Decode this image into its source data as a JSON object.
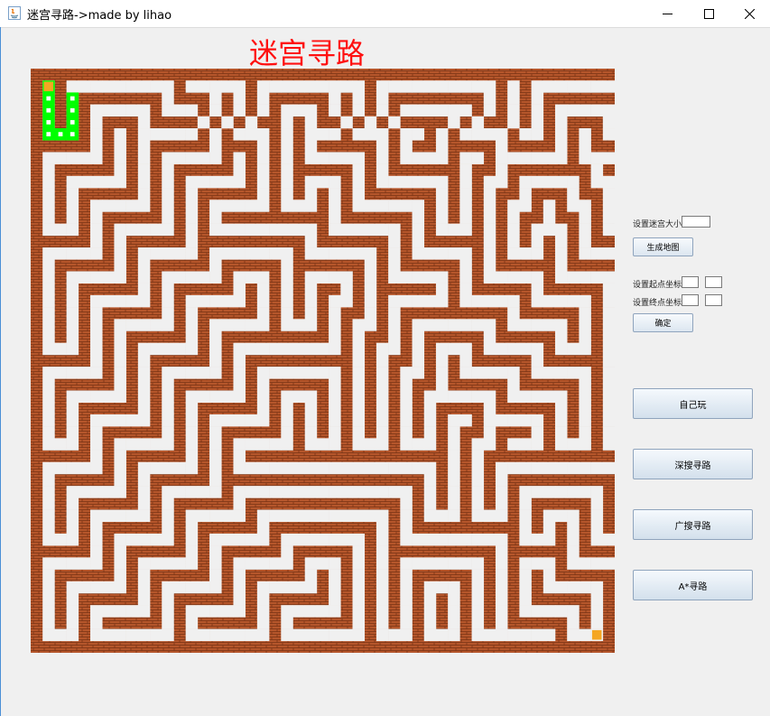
{
  "window": {
    "title": "迷宫寻路->made by lihao",
    "controls": [
      "minimize-icon",
      "maximize-icon",
      "close-icon"
    ]
  },
  "heading": "迷宫寻路",
  "colors": {
    "heading": "#ff1010",
    "wall": "#b5562b",
    "mortar": "#7a3414",
    "path": "#f0f0f0",
    "visited": "#00ff00",
    "route": "#0b3a0b",
    "marker": "#f5a623"
  },
  "maze": {
    "rows": 25,
    "cols": 25,
    "grid": [
      "wwwwwwwwwwwwwwwwwwwwwwwwwwwwwwwwwwwwwwwwwwwwwwwwwwwww",
      "w.w.........w.....w.........w..........w.w.........w",
      "w.w.wwwwwww.www.w.w.wwwww.w.w.wwwwwwww.w.w.wwwwwww.w",
      "w.w.w.....w...w.w.w.w...w.w.w.w......w.w.w.w.....w.w",
      "w.w.w.www.wwww.w.w.ww.w.ww.w.w.wwww.w.ww.w.w.www.w.w",
      "w...w.w.w.....w.w...w.w...w...w..w.w....w..w.w.w...w",
      "wwwww.w.w.wwwww.www.w.w.wwwww.w.ww.wwww.wwww.w.wwwww",
      "w.....w.w.w.....w.w.w.w.....w.w....w..w......w.....w",
      "w.wwwww.w.w.wwwww.w.w.wwwww.w.wwwwww.ww.wwwwwww.ww.w",
      "w.w.....w.w.w.....w.w.w...w.w......w.w..w.....w..w.w",
      "w.w.wwwww.w.w.wwwww.w.w.w.w.wwwwww.w.w.ww.www.ww.w.w",
      "w.w.w.....w.w.w.....w...w.w......w.w.w.w..w.w..w.w.w",
      "w.w.w.wwwww.w.w.wwwwwwwww.wwwwww.w.w.w.w.ww.ww.w.w.w",
      "w...w.w.....w.w.........w......w.w...w.w.w...w.w...w",
      "wwwww.w.wwwww.wwwwwwwww.wwwwww.w.wwwww.w.w.w.w.wwwww",
      "w.....w.w.....w.......w......w.w.....w.w...w.w.....w",
      "w.wwwww.w.wwwww.wwwww.wwwwww.w.wwwww.w.wwwww.wwwww.w",
      "w.w.....w.w.....w...w.w....w.w.....w.w.....w.....w.w",
      "w.w.wwwww.w.wwwww.w.w.w.ww.w.wwwww.w.wwwww.wwwww.w.w",
      "w.w.w.....w.w.....w.w.w.w..w.w.....w.....w.....w.w.w",
      "w.w.w.wwwww.w.wwwww.w.w.w.ww.w.wwwwwwwww.wwwww.w.w.w",
      "w.w.w.w.....w.w.....w...w.w..w.w.......w.....w.w.w.w",
      "w.w.w.w.wwwww.w.wwwwwwwww.w.ww.w.wwwww.wwwww.w.w.w.w",
      "w...w.w.w.....w.w.........w.w..w.w...w.....w...w...w",
      "wwwww.w.w.wwwww.w.wwwwwwwww.w.ww.w.w.wwwww.wwwww.w.w",
      "w.....w.w.w.....w.w.......w.w.w..w.w.....w.....w.w.w",
      "w.wwwww.w.w.wwwww.w.wwwww.w.w.w.ww.wwwww.wwwww.w.w.w",
      "w.w.....w.w.w.....w.w...w.w.w.w.w......w.....w.w.w.w",
      "w.w.wwwww.w.w.wwwww.w.w.w.w.w.w.w.wwww.wwwww.w.w.w.w",
      "w.w.w.....w.w.w.....w.w.w.w.w.w.w.w..w.....w.w.w.w.w",
      "w.w.w.wwwww.w.w.wwwww.w.w.w.w.w.w.w.ww.www.w.w.w.w.w",
      "w...w.w.....w.w.w.....w...w...w...w.w..w...w...w...w",
      "wwwww.w.wwwww.w.w.wwwwwwwwwwwwwwwww.w.wwwwwwwwwwwww.w",
      "w.....w.w.....w.w.................w.w.w...........w.w",
      "w.wwwww.w.wwwww.wwwwwwwwwwwwwwwww.w.w.w.wwwwwwwww.w.w",
      "w.w.....w.w.....w...............w.w.w.w.w.......w.w.w",
      "w.w.wwwww.w.wwwww.wwwwwwwwwwwww.w.w.w.w.w.wwwww.w.w.w",
      "w.w.w.....w.w.....w...........w.w...w...w.w...w.w...w",
      "w.w.w.wwwww.w.wwwww.wwwwwwwww.w.wwwwwwwww.w.w.w.wwwww",
      "w...w.w.....w.w.....w.......w.w.........w...w.w.....w",
      "wwwww.w.wwwww.w.wwwww.wwwww.w.wwwwwwwww.wwwww.wwwww.w",
      "w.....w.w.....w.w.....w...w.w.w.......w.w...w.....w.w",
      "w.wwwww.w.wwwww.w.wwwww.w.w.w.w.wwwww.w.w.w.wwwww.w.w",
      "w.w.....w.w.....w.w.....w.w.w.w.w...w.w.w.w.....w.w.w",
      "w.w.wwwww.w.wwwww.w.wwwww.w.w.w.w.w.w.w.w.wwwww.w.w.w",
      "w.w.w.....w.w.....w.w.....w.w.w.w.w.w.w.w.....w.w.w.w",
      "w.w.w.wwwww.w.wwwww.w.wwwww.w.w.w.w.w.w.wwwww.w.w.w.w",
      "w...w.......w.......w.......w...w...w.......w...w...w",
      "wwwwwwwwwwwwwwwwwwwwwwwwwwwwwwwwwwwwwwwwwwwwwwwwwwwww"
    ]
  },
  "side": {
    "size_label": "设置迷宫大小",
    "size_value": "",
    "generate_button": "生成地图",
    "start_label": "设置起点坐标",
    "start_x": "",
    "start_y": "",
    "end_label": "设置终点坐标",
    "end_x": "",
    "end_y": "",
    "confirm_button": "确定"
  },
  "actions": {
    "play": "自己玩",
    "dfs": "深搜寻路",
    "bfs": "广搜寻路",
    "astar": "A*寻路"
  }
}
